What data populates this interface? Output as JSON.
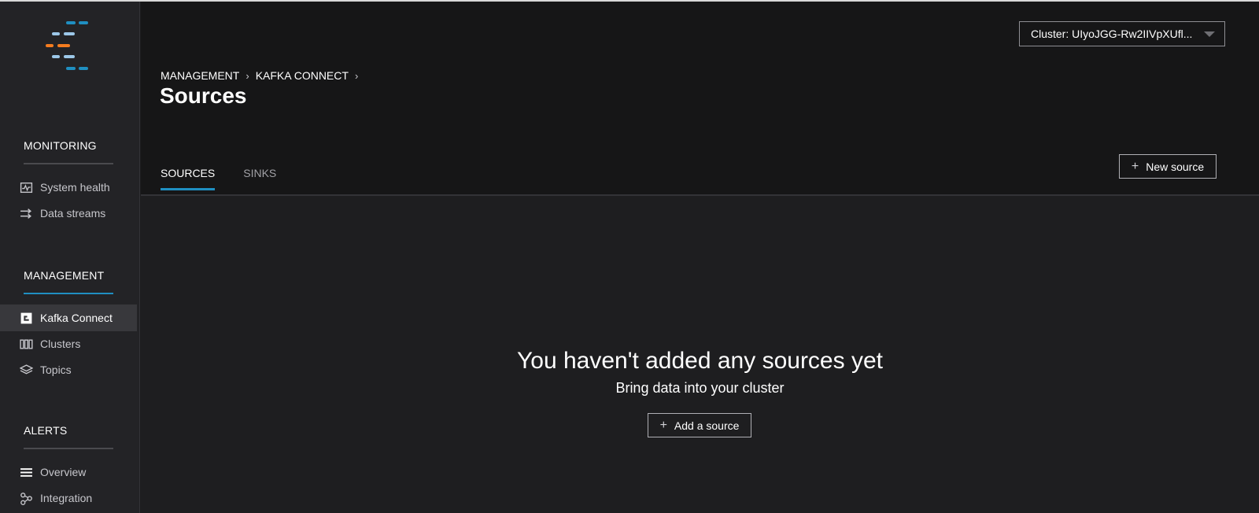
{
  "sidebar": {
    "logo_name": "app-logo",
    "sections": [
      {
        "title": "MONITORING",
        "items": [
          {
            "label": "System health",
            "icon": "pulse-chart-icon"
          },
          {
            "label": "Data streams",
            "icon": "arrows-swap-icon"
          }
        ]
      },
      {
        "title": "MANAGEMENT",
        "items": [
          {
            "label": "Kafka Connect",
            "icon": "connect-icon"
          },
          {
            "label": "Clusters",
            "icon": "clusters-icon"
          },
          {
            "label": "Topics",
            "icon": "layers-icon"
          }
        ]
      },
      {
        "title": "ALERTS",
        "items": [
          {
            "label": "Overview",
            "icon": "menu-lines-icon"
          },
          {
            "label": "Integration",
            "icon": "integration-icon"
          }
        ]
      }
    ],
    "active_item": "Kafka Connect"
  },
  "header": {
    "cluster_select": "Cluster: UIyoJGG-Rw2IIVpXUfl...",
    "breadcrumb": [
      "MANAGEMENT",
      "KAFKA CONNECT"
    ],
    "title": "Sources"
  },
  "tabs": [
    {
      "label": "SOURCES",
      "active": true
    },
    {
      "label": "SINKS",
      "active": false
    }
  ],
  "actions": {
    "new_source_label": "New source",
    "plus_glyph": "+"
  },
  "empty_state": {
    "title": "You haven't added any sources yet",
    "subtitle": "Bring data into your cluster",
    "button_label": "Add a source"
  },
  "colors": {
    "accent": "#1f8fc1",
    "logo_orange": "#f57c1f",
    "logo_light_blue": "#9cc7e8",
    "background": "#1e1e20",
    "sidebar": "#232326"
  }
}
